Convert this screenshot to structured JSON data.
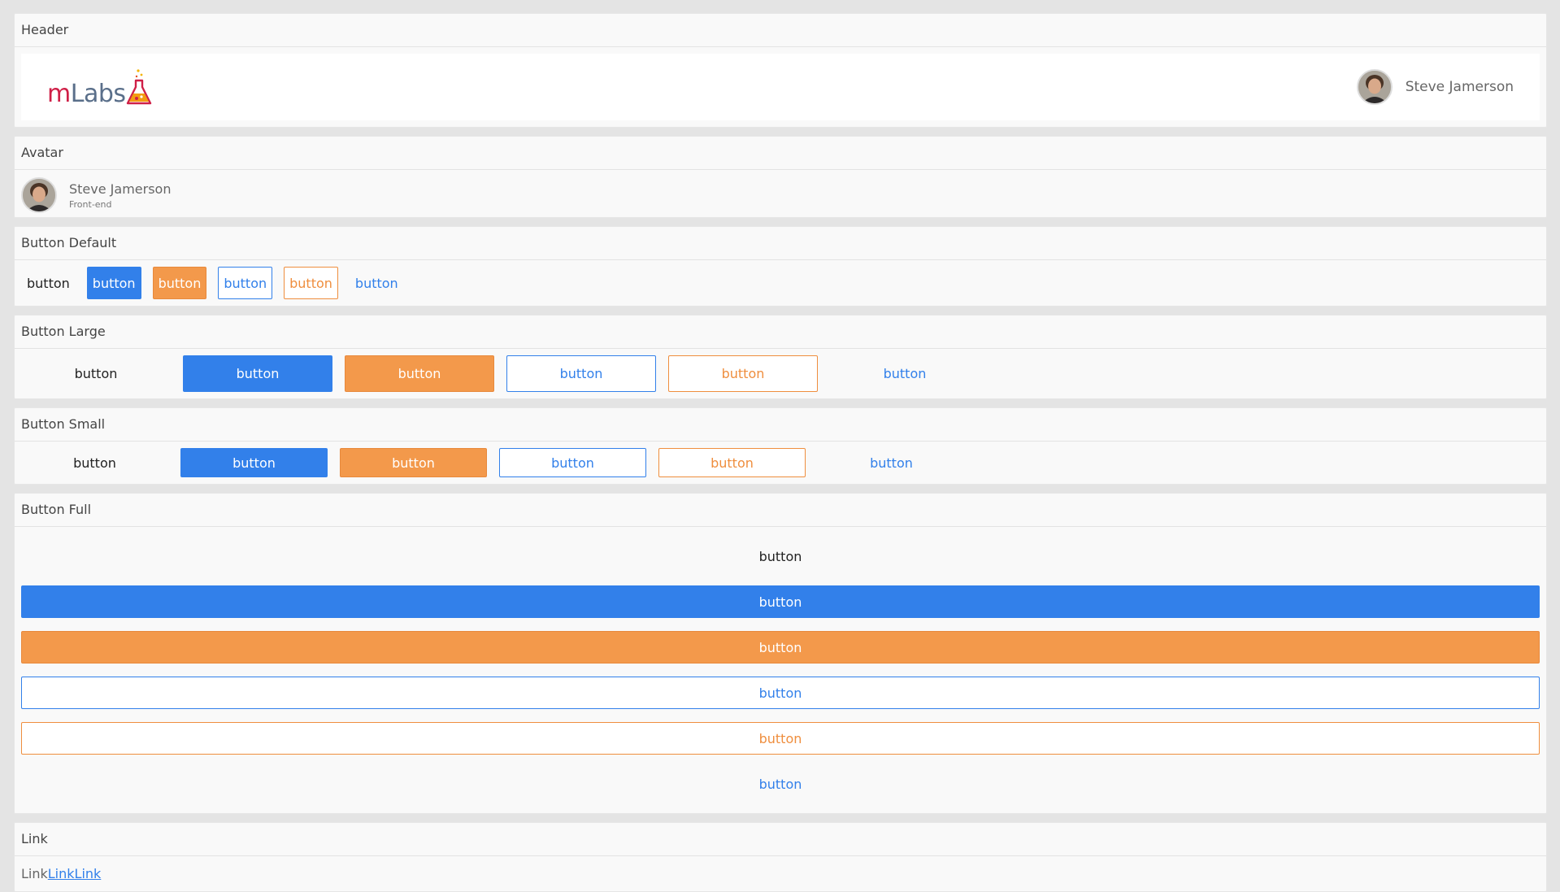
{
  "sections": {
    "header": "Header",
    "avatar": "Avatar",
    "button_default": "Button Default",
    "button_large": "Button Large",
    "button_small": "Button Small",
    "button_full": "Button Full",
    "link": "Link"
  },
  "header": {
    "logo_m": "m",
    "logo_labs": "Labs",
    "user_name": "Steve Jamerson"
  },
  "avatar": {
    "name": "Steve Jamerson",
    "role": "Front-end"
  },
  "buttons": {
    "text": "button",
    "primary": "button",
    "secondary": "button",
    "outline_primary": "button",
    "outline_secondary": "button",
    "link": "button"
  },
  "links": {
    "plain": "Link",
    "link1": "Link",
    "link2": "Link"
  },
  "colors": {
    "primary": "#3280ea",
    "secondary": "#f3994b",
    "brand": "#cf1f47"
  }
}
